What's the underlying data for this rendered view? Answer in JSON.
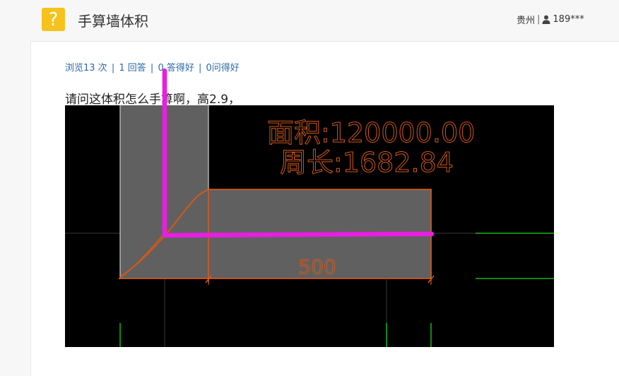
{
  "header": {
    "logo_icon": "question-mark-icon",
    "logo_glyph": "?",
    "title": "手算墙体积",
    "location": "贵州",
    "separator": "|",
    "user_id": "189***"
  },
  "stats": {
    "views": "浏览13 次",
    "answers": "1 回答",
    "good_answers": "0 答得好",
    "good_questions": "0问得好",
    "divider": "|"
  },
  "question": {
    "text": "请问这体积怎么手算啊，高2.9，"
  },
  "drawing": {
    "area_label": "面积:120000.00",
    "perimeter_label": "周长:1682.84",
    "dimension_label": "500",
    "colors": {
      "background": "#000000",
      "fill": "#606060",
      "orange": "#d2591a",
      "magenta": "#e81ee0",
      "green": "#14b814",
      "white_wall": "#cfcfcf"
    }
  }
}
